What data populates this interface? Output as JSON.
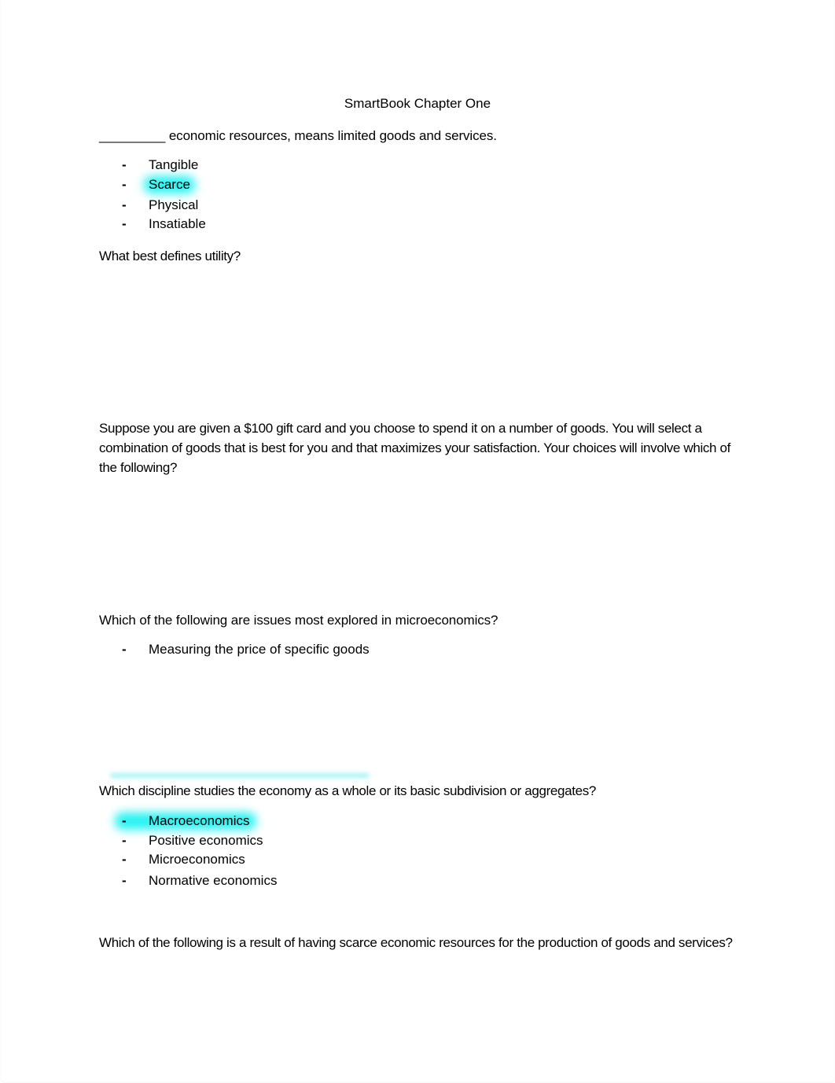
{
  "document": {
    "title": "SmartBook Chapter One",
    "highlight_color": "#00FFFF",
    "questions": [
      {
        "prompt": "_________ economic resources, means limited goods and services.",
        "options": [
          {
            "label": "Tangible",
            "highlighted": false
          },
          {
            "label": "Scarce",
            "highlighted": true
          },
          {
            "label": "Physical",
            "highlighted": false
          },
          {
            "label": "Insatiable",
            "highlighted": false
          }
        ]
      },
      {
        "prompt": "What best defines utility?",
        "options": []
      },
      {
        "prompt": "Suppose you are given a $100 gift card and you choose to spend it on a number of goods. You will select a combination of goods that is best for you and that maximizes your satisfaction. Your choices will involve which of the following?",
        "options": []
      },
      {
        "prompt": "Which of the following are issues most explored in microeconomics?",
        "options": [
          {
            "label": "Measuring the price of specific goods",
            "highlighted": false
          }
        ]
      },
      {
        "prompt": "Which discipline studies the economy as a whole or its basic subdivision or aggregates?",
        "options": [
          {
            "label": "Macroeconomics",
            "highlighted": true
          },
          {
            "label": "Positive economics",
            "highlighted": false
          },
          {
            "label": "Microeconomics",
            "highlighted": false
          },
          {
            "label": "Normative economics",
            "highlighted": false
          }
        ]
      },
      {
        "prompt": "Which of the following is a result of having scarce economic resources for the production of goods and services?",
        "options": []
      }
    ],
    "bullet_glyph": "-"
  }
}
